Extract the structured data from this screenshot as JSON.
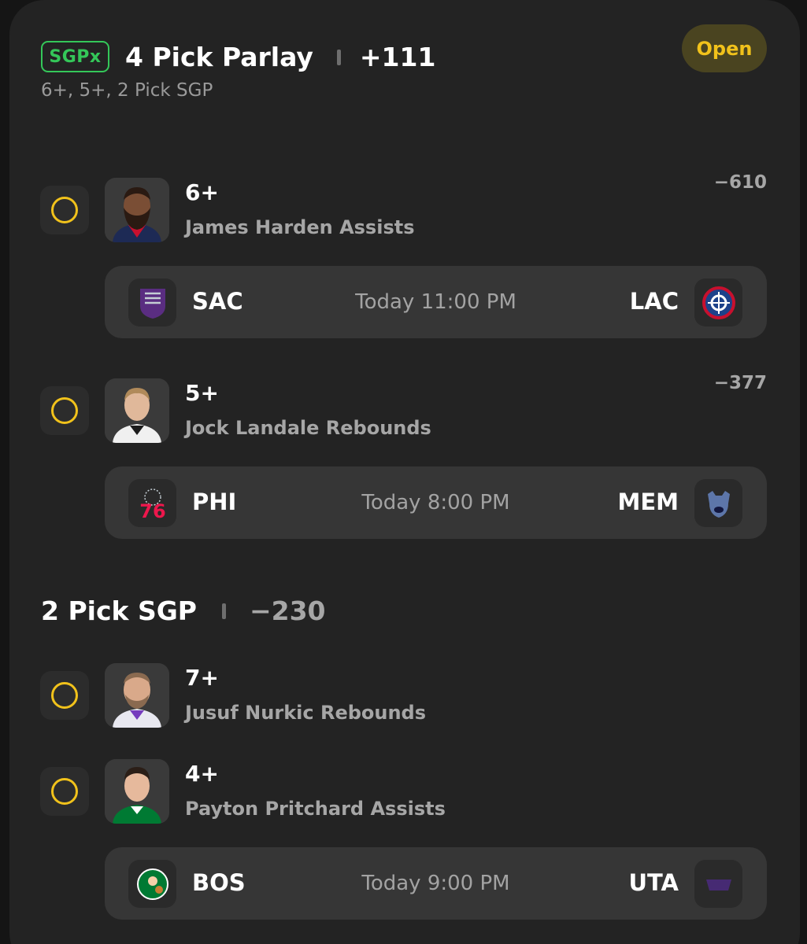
{
  "header": {
    "badge": "SGPx",
    "title": "4 Pick Parlay",
    "odds": "+111",
    "subtitle": "6+, 5+, 2 Pick SGP",
    "status": "Open"
  },
  "picks": [
    {
      "line": "6+",
      "desc": "James Harden Assists",
      "odds": "−610"
    },
    {
      "line": "5+",
      "desc": "Jock Landale Rebounds",
      "odds": "−377"
    },
    {
      "line": "7+",
      "desc": "Jusuf Nurkic Rebounds"
    },
    {
      "line": "4+",
      "desc": "Payton Pritchard Assists"
    }
  ],
  "games": [
    {
      "away": "SAC",
      "time": "Today 11:00 PM",
      "home": "LAC"
    },
    {
      "away": "PHI",
      "time": "Today 8:00 PM",
      "home": "MEM"
    },
    {
      "away": "BOS",
      "time": "Today 9:00 PM",
      "home": "UTA"
    }
  ],
  "sgp": {
    "title": "2 Pick SGP",
    "odds": "−230"
  },
  "icons": {
    "check": "empty-circle-icon",
    "avatar": "player-headshot",
    "team_logos": [
      "kings-logo",
      "clippers-logo",
      "76ers-logo",
      "grizzlies-logo",
      "celtics-logo",
      "jazz-logo"
    ]
  },
  "colors": {
    "accent_yellow": "#f1c21b",
    "sgpx_green": "#34c759",
    "card_bg": "#232323",
    "row_bg": "#363636"
  }
}
